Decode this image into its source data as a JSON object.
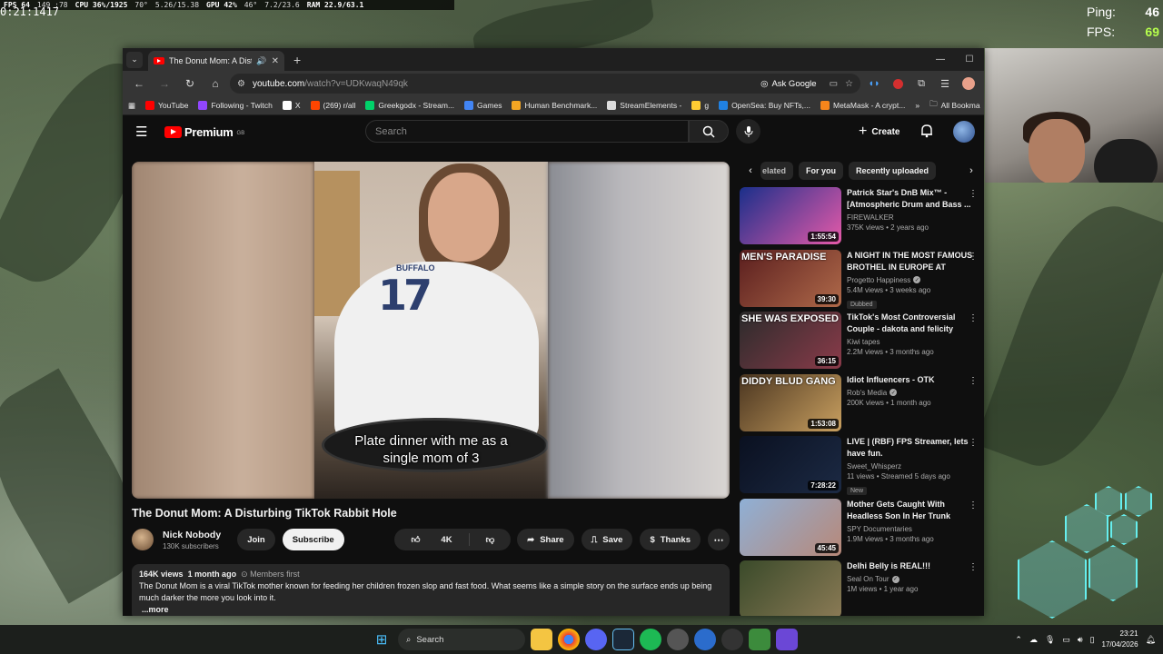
{
  "overlay": {
    "clock": "0:21:1417",
    "perf": [
      "FPS 64",
      "149 :78",
      "CPU 36%/1925",
      "70°",
      "5.26/15.38",
      "GPU 42%",
      "46°",
      "7.2/23.6",
      "RAM 22.9/63.1"
    ],
    "ping_label": "Ping:",
    "ping_value": "46",
    "fps_label": "FPS:",
    "fps_value": "69"
  },
  "browser": {
    "tab_title": "The Donut Mom: A Disturbi",
    "url_host": "youtube.com",
    "url_path": "/watch?v=UDKwaqN49qk",
    "ask_google": "Ask Google",
    "bookmarks": [
      {
        "label": "YouTube",
        "color": "#ff0000"
      },
      {
        "label": "Following - Twitch",
        "color": "#9146ff"
      },
      {
        "label": "X",
        "color": "#ffffff"
      },
      {
        "label": "(269) r/all",
        "color": "#ff4500"
      },
      {
        "label": "Greekgodx - Stream...",
        "color": "#00d26a"
      },
      {
        "label": "Games",
        "color": "#4285f4"
      },
      {
        "label": "Human Benchmark...",
        "color": "#f5a623"
      },
      {
        "label": "StreamElements -",
        "color": "#dddddd"
      },
      {
        "label": "g",
        "color": "#ffcc33"
      },
      {
        "label": "OpenSea: Buy NFTs,...",
        "color": "#2081e2"
      },
      {
        "label": "MetaMask - A crypt...",
        "color": "#f6851b"
      }
    ],
    "all_bookmarks": "All Bookma"
  },
  "yt": {
    "logo_word": "Premium",
    "logo_region": "GB",
    "search_placeholder": "Search",
    "create_label": "Create",
    "subtitle_line1": "Plate dinner with me as a",
    "subtitle_line2": "single mom of 3",
    "shirt_text": "BUFFALO",
    "shirt_number": "17",
    "video_title": "The Donut Mom: A Disturbing TikTok Rabbit Hole",
    "channel_name": "Nick Nobody",
    "channel_subs": "130K subscribers",
    "join_label": "Join",
    "subscribe_label": "Subscribe",
    "likes": "4K",
    "share_label": "Share",
    "save_label": "Save",
    "thanks_label": "Thanks",
    "desc_views": "164K views",
    "desc_date": "1 month ago",
    "desc_members": "Members first",
    "desc_text": "The Donut Mom is a viral TikTok mother known for feeding her children frozen slop and fast food. What seems like a simple story on the surface ends up being much darker the more you look into it.",
    "desc_more": "...more",
    "chips": [
      "elated",
      "For you",
      "Recently uploaded"
    ],
    "recs": [
      {
        "title": "Patrick Star's DnB Mix™ - [Atmospheric Drum and Bass ...",
        "channel": "FIREWALKER",
        "verified": false,
        "stats": "375K views • 2 years ago",
        "duration": "1:55:54",
        "badge": "",
        "thumb_text": "",
        "c1": "#1a2f8a",
        "c2": "#e65aa9"
      },
      {
        "title": "A NIGHT IN THE MOST FAMOUS BROTHEL IN EUROPE AT",
        "channel": "Progetto Happiness",
        "verified": true,
        "stats": "5.4M views • 3 weeks ago",
        "duration": "39:30",
        "badge": "Dubbed",
        "thumb_text": "MEN'S PARADISE",
        "c1": "#5a1e1e",
        "c2": "#b06a4a"
      },
      {
        "title": "TikTok's Most Controversial Couple - dakota and felicity",
        "channel": "Kiwi tapes",
        "verified": false,
        "stats": "2.2M views • 3 months ago",
        "duration": "36:15",
        "badge": "",
        "thumb_text": "SHE WAS EXPOSED",
        "c1": "#2b2b2b",
        "c2": "#8b3b4a"
      },
      {
        "title": "Idiot Influencers - OTK",
        "channel": "Rob's Media",
        "verified": true,
        "stats": "200K views • 1 month ago",
        "duration": "1:53:08",
        "badge": "",
        "thumb_text": "DIDDY BLUD GANG",
        "c1": "#4a3520",
        "c2": "#c9a060"
      },
      {
        "title": "LIVE | (RBF) FPS Streamer, lets have fun.",
        "channel": "Sweet_Whisperz",
        "verified": false,
        "stats": "11 views • Streamed 5 days ago",
        "duration": "7:28:22",
        "badge": "New",
        "thumb_text": "",
        "c1": "#0a1020",
        "c2": "#1c2a44"
      },
      {
        "title": "Mother Gets Caught With Headless Son In Her Trunk",
        "channel": "SPY Documentaries",
        "verified": false,
        "stats": "1.9M views • 3 months ago",
        "duration": "45:45",
        "badge": "",
        "thumb_text": "",
        "c1": "#8fb0d6",
        "c2": "#b88878"
      },
      {
        "title": "Delhi Belly is REAL!!!",
        "channel": "Seal On Tour",
        "verified": true,
        "stats": "1M views • 1 year ago",
        "duration": "",
        "badge": "",
        "thumb_text": "",
        "c1": "#3a4a2a",
        "c2": "#8a7a55"
      }
    ]
  },
  "taskbar": {
    "search_label": "Search",
    "time": "23:21",
    "date": "17/04/2026"
  }
}
